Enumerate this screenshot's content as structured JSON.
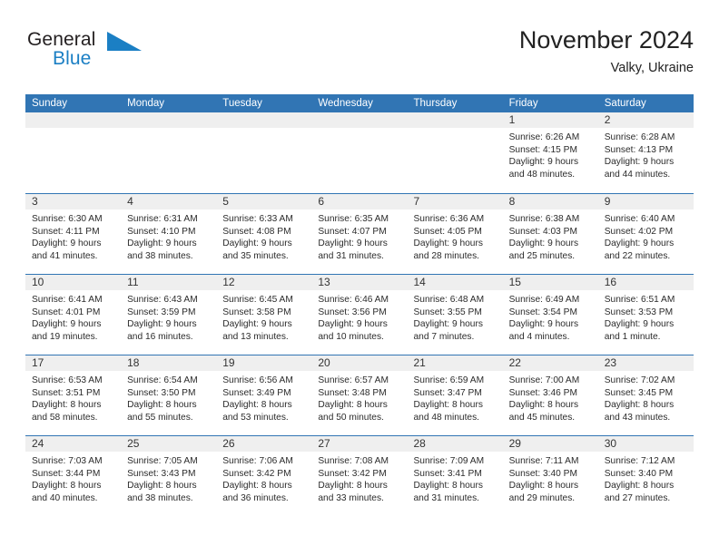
{
  "brand": {
    "name_part1": "General",
    "name_part2": "Blue",
    "triangle_color": "#1b7fc4",
    "blue_color": "#1b7fc4",
    "dark_color": "#231f20"
  },
  "header": {
    "title": "November 2024",
    "subtitle": "Valky, Ukraine"
  },
  "theme": {
    "header_blue": "#3175b4",
    "daynum_strip": "#efefef"
  },
  "calendar": {
    "weekday_headers": [
      "Sunday",
      "Monday",
      "Tuesday",
      "Wednesday",
      "Thursday",
      "Friday",
      "Saturday"
    ],
    "weeks": [
      [
        {
          "empty": true
        },
        {
          "empty": true
        },
        {
          "empty": true
        },
        {
          "empty": true
        },
        {
          "empty": true
        },
        {
          "day": "1",
          "sunrise": "Sunrise: 6:26 AM",
          "sunset": "Sunset: 4:15 PM",
          "daylight1": "Daylight: 9 hours",
          "daylight2": "and 48 minutes."
        },
        {
          "day": "2",
          "sunrise": "Sunrise: 6:28 AM",
          "sunset": "Sunset: 4:13 PM",
          "daylight1": "Daylight: 9 hours",
          "daylight2": "and 44 minutes."
        }
      ],
      [
        {
          "day": "3",
          "sunrise": "Sunrise: 6:30 AM",
          "sunset": "Sunset: 4:11 PM",
          "daylight1": "Daylight: 9 hours",
          "daylight2": "and 41 minutes."
        },
        {
          "day": "4",
          "sunrise": "Sunrise: 6:31 AM",
          "sunset": "Sunset: 4:10 PM",
          "daylight1": "Daylight: 9 hours",
          "daylight2": "and 38 minutes."
        },
        {
          "day": "5",
          "sunrise": "Sunrise: 6:33 AM",
          "sunset": "Sunset: 4:08 PM",
          "daylight1": "Daylight: 9 hours",
          "daylight2": "and 35 minutes."
        },
        {
          "day": "6",
          "sunrise": "Sunrise: 6:35 AM",
          "sunset": "Sunset: 4:07 PM",
          "daylight1": "Daylight: 9 hours",
          "daylight2": "and 31 minutes."
        },
        {
          "day": "7",
          "sunrise": "Sunrise: 6:36 AM",
          "sunset": "Sunset: 4:05 PM",
          "daylight1": "Daylight: 9 hours",
          "daylight2": "and 28 minutes."
        },
        {
          "day": "8",
          "sunrise": "Sunrise: 6:38 AM",
          "sunset": "Sunset: 4:03 PM",
          "daylight1": "Daylight: 9 hours",
          "daylight2": "and 25 minutes."
        },
        {
          "day": "9",
          "sunrise": "Sunrise: 6:40 AM",
          "sunset": "Sunset: 4:02 PM",
          "daylight1": "Daylight: 9 hours",
          "daylight2": "and 22 minutes."
        }
      ],
      [
        {
          "day": "10",
          "sunrise": "Sunrise: 6:41 AM",
          "sunset": "Sunset: 4:01 PM",
          "daylight1": "Daylight: 9 hours",
          "daylight2": "and 19 minutes."
        },
        {
          "day": "11",
          "sunrise": "Sunrise: 6:43 AM",
          "sunset": "Sunset: 3:59 PM",
          "daylight1": "Daylight: 9 hours",
          "daylight2": "and 16 minutes."
        },
        {
          "day": "12",
          "sunrise": "Sunrise: 6:45 AM",
          "sunset": "Sunset: 3:58 PM",
          "daylight1": "Daylight: 9 hours",
          "daylight2": "and 13 minutes."
        },
        {
          "day": "13",
          "sunrise": "Sunrise: 6:46 AM",
          "sunset": "Sunset: 3:56 PM",
          "daylight1": "Daylight: 9 hours",
          "daylight2": "and 10 minutes."
        },
        {
          "day": "14",
          "sunrise": "Sunrise: 6:48 AM",
          "sunset": "Sunset: 3:55 PM",
          "daylight1": "Daylight: 9 hours",
          "daylight2": "and 7 minutes."
        },
        {
          "day": "15",
          "sunrise": "Sunrise: 6:49 AM",
          "sunset": "Sunset: 3:54 PM",
          "daylight1": "Daylight: 9 hours",
          "daylight2": "and 4 minutes."
        },
        {
          "day": "16",
          "sunrise": "Sunrise: 6:51 AM",
          "sunset": "Sunset: 3:53 PM",
          "daylight1": "Daylight: 9 hours",
          "daylight2": "and 1 minute."
        }
      ],
      [
        {
          "day": "17",
          "sunrise": "Sunrise: 6:53 AM",
          "sunset": "Sunset: 3:51 PM",
          "daylight1": "Daylight: 8 hours",
          "daylight2": "and 58 minutes."
        },
        {
          "day": "18",
          "sunrise": "Sunrise: 6:54 AM",
          "sunset": "Sunset: 3:50 PM",
          "daylight1": "Daylight: 8 hours",
          "daylight2": "and 55 minutes."
        },
        {
          "day": "19",
          "sunrise": "Sunrise: 6:56 AM",
          "sunset": "Sunset: 3:49 PM",
          "daylight1": "Daylight: 8 hours",
          "daylight2": "and 53 minutes."
        },
        {
          "day": "20",
          "sunrise": "Sunrise: 6:57 AM",
          "sunset": "Sunset: 3:48 PM",
          "daylight1": "Daylight: 8 hours",
          "daylight2": "and 50 minutes."
        },
        {
          "day": "21",
          "sunrise": "Sunrise: 6:59 AM",
          "sunset": "Sunset: 3:47 PM",
          "daylight1": "Daylight: 8 hours",
          "daylight2": "and 48 minutes."
        },
        {
          "day": "22",
          "sunrise": "Sunrise: 7:00 AM",
          "sunset": "Sunset: 3:46 PM",
          "daylight1": "Daylight: 8 hours",
          "daylight2": "and 45 minutes."
        },
        {
          "day": "23",
          "sunrise": "Sunrise: 7:02 AM",
          "sunset": "Sunset: 3:45 PM",
          "daylight1": "Daylight: 8 hours",
          "daylight2": "and 43 minutes."
        }
      ],
      [
        {
          "day": "24",
          "sunrise": "Sunrise: 7:03 AM",
          "sunset": "Sunset: 3:44 PM",
          "daylight1": "Daylight: 8 hours",
          "daylight2": "and 40 minutes."
        },
        {
          "day": "25",
          "sunrise": "Sunrise: 7:05 AM",
          "sunset": "Sunset: 3:43 PM",
          "daylight1": "Daylight: 8 hours",
          "daylight2": "and 38 minutes."
        },
        {
          "day": "26",
          "sunrise": "Sunrise: 7:06 AM",
          "sunset": "Sunset: 3:42 PM",
          "daylight1": "Daylight: 8 hours",
          "daylight2": "and 36 minutes."
        },
        {
          "day": "27",
          "sunrise": "Sunrise: 7:08 AM",
          "sunset": "Sunset: 3:42 PM",
          "daylight1": "Daylight: 8 hours",
          "daylight2": "and 33 minutes."
        },
        {
          "day": "28",
          "sunrise": "Sunrise: 7:09 AM",
          "sunset": "Sunset: 3:41 PM",
          "daylight1": "Daylight: 8 hours",
          "daylight2": "and 31 minutes."
        },
        {
          "day": "29",
          "sunrise": "Sunrise: 7:11 AM",
          "sunset": "Sunset: 3:40 PM",
          "daylight1": "Daylight: 8 hours",
          "daylight2": "and 29 minutes."
        },
        {
          "day": "30",
          "sunrise": "Sunrise: 7:12 AM",
          "sunset": "Sunset: 3:40 PM",
          "daylight1": "Daylight: 8 hours",
          "daylight2": "and 27 minutes."
        }
      ]
    ]
  }
}
